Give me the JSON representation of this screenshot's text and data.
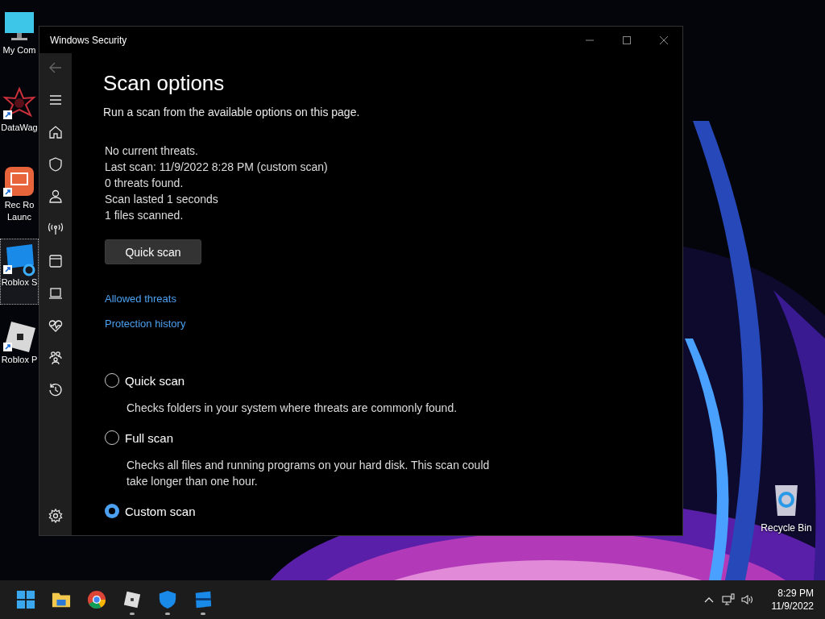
{
  "desktop_icons": [
    {
      "label": "My Com",
      "kind": "monitor",
      "shortcut": false,
      "selected": false
    },
    {
      "label": "DataWag",
      "kind": "star",
      "shortcut": true,
      "selected": false
    },
    {
      "label": "Rec Ro Launc",
      "kind": "orange",
      "shortcut": true,
      "selected": false
    },
    {
      "label": "Roblox S",
      "kind": "studio",
      "shortcut": true,
      "selected": true
    },
    {
      "label": "Roblox P",
      "kind": "roblox",
      "shortcut": true,
      "selected": false
    }
  ],
  "recycle_bin": {
    "label": "Recycle Bin"
  },
  "window": {
    "title": "Windows Security"
  },
  "nav": [
    {
      "kind": "back",
      "disabled": true
    },
    {
      "kind": "menu",
      "disabled": false
    },
    {
      "kind": "home",
      "disabled": false
    },
    {
      "kind": "shield",
      "disabled": false
    },
    {
      "kind": "person",
      "disabled": false
    },
    {
      "kind": "antenna",
      "disabled": false
    },
    {
      "kind": "browser",
      "disabled": false
    },
    {
      "kind": "laptop",
      "disabled": false
    },
    {
      "kind": "heart",
      "disabled": false
    },
    {
      "kind": "family",
      "disabled": false
    },
    {
      "kind": "history",
      "disabled": false
    }
  ],
  "nav_bottom": [
    {
      "kind": "settings",
      "disabled": false
    }
  ],
  "page": {
    "title": "Scan options",
    "subtitle": "Run a scan from the available options on this page.",
    "status_lines": [
      "No current threats.",
      "Last scan: 11/9/2022 8:28 PM (custom scan)",
      "0 threats found.",
      "Scan lasted 1 seconds",
      "1 files scanned."
    ],
    "button": "Quick scan",
    "links": [
      "Allowed threats",
      "Protection history"
    ],
    "options": [
      {
        "label": "Quick scan",
        "description": "Checks folders in your system where threats are commonly found.",
        "selected": false
      },
      {
        "label": "Full scan",
        "description": "Checks all files and running programs on your hard disk. This scan could take longer than one hour.",
        "selected": false
      },
      {
        "label": "Custom scan",
        "selected": true
      }
    ]
  },
  "taskbar": {
    "apps": [
      {
        "kind": "start",
        "running": false
      },
      {
        "kind": "folder",
        "running": false
      },
      {
        "kind": "chrome",
        "running": false
      },
      {
        "kind": "roblox",
        "running": true
      },
      {
        "kind": "shield",
        "running": true
      },
      {
        "kind": "studio",
        "running": true
      }
    ],
    "time": "8:29 PM",
    "date": "11/9/2022"
  }
}
